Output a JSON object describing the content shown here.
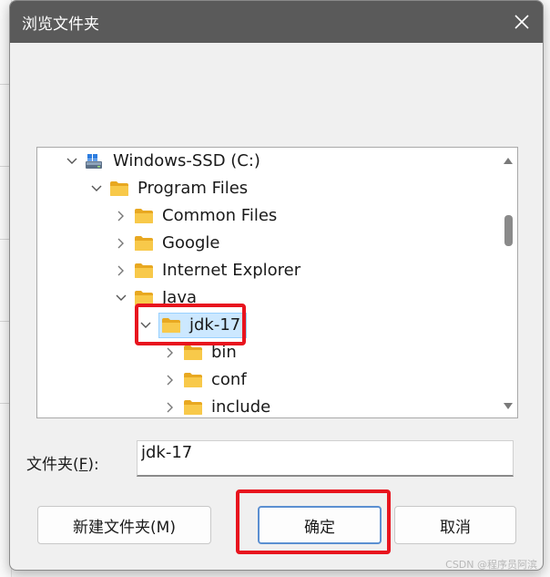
{
  "dialog": {
    "title": "浏览文件夹",
    "close_symbol": "✕"
  },
  "tree": {
    "nodes": [
      {
        "label": "Windows-SSD (C:)",
        "expanded": true,
        "icon": "drive-icon"
      },
      {
        "label": "Program Files",
        "expanded": true,
        "icon": "folder-icon"
      },
      {
        "label": "Common Files",
        "expanded": false,
        "icon": "folder-icon"
      },
      {
        "label": "Google",
        "expanded": false,
        "icon": "folder-icon"
      },
      {
        "label": "Internet Explorer",
        "expanded": false,
        "icon": "folder-icon"
      },
      {
        "label": "Java",
        "expanded": true,
        "icon": "folder-icon"
      },
      {
        "label": "jdk-17",
        "expanded": true,
        "selected": true,
        "icon": "folder-icon"
      },
      {
        "label": "bin",
        "expanded": false,
        "icon": "folder-icon"
      },
      {
        "label": "conf",
        "expanded": false,
        "icon": "folder-icon"
      },
      {
        "label": "include",
        "expanded": false,
        "icon": "folder-icon"
      }
    ]
  },
  "folder_field": {
    "label_prefix": "文件夹(",
    "label_key": "F",
    "label_suffix": "):",
    "value": "jdk-17"
  },
  "buttons": {
    "new_folder": "新建文件夹(M)",
    "ok": "确定",
    "cancel": "取消"
  },
  "colors": {
    "titlebar": "#5a5a5a",
    "selection_bg": "#cce8ff",
    "highlight_red": "#e8141e",
    "folder_yellow": "#f8c94a"
  },
  "watermark": "CSDN @程序员阿滨"
}
